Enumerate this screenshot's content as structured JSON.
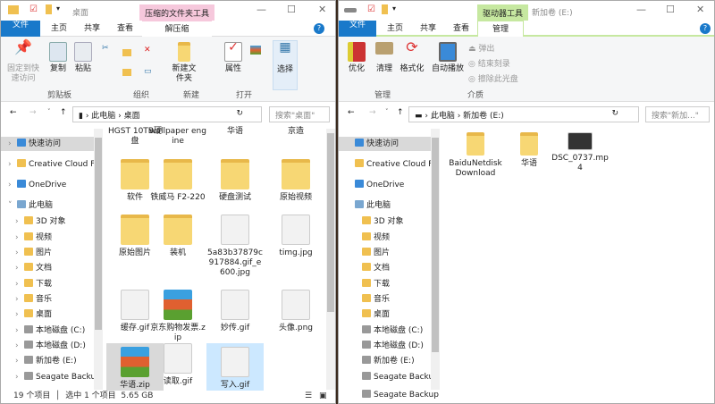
{
  "left": {
    "title": "桌面",
    "context_tab": "压缩的文件夹工具",
    "tabs": [
      "文件",
      "主页",
      "共享",
      "查看",
      "解压缩"
    ],
    "ribbon": {
      "buttons": [
        "固定到快速访问",
        "复制",
        "粘贴",
        "新建文件夹",
        "属性",
        "选择"
      ],
      "groups": [
        "剪贴板",
        "组织",
        "新建",
        "打开"
      ]
    },
    "address": {
      "path": [
        "此电脑",
        "桌面"
      ],
      "search_placeholder": "搜索\"桌面\""
    },
    "nav": [
      "快速访问",
      "Creative Cloud F",
      "OneDrive",
      "此电脑",
      "3D 对象",
      "视频",
      "图片",
      "文档",
      "下载",
      "音乐",
      "桌面",
      "本地磁盘 (C:)",
      "本地磁盘 (D:)",
      "新加卷 (E:)",
      "Seagate Backup"
    ],
    "files": [
      "HGST 10TB硬盘",
      "wallpaper engine",
      "华语",
      "京造",
      "软件",
      "铁威马 F2-220",
      "硬盘测试",
      "原始视频",
      "原始图片",
      "装机",
      "5a83b37879c917884.gif_e600.jpg",
      "timg.jpg",
      "缓存.gif",
      "京东购物发票.zip",
      "妙传.gif",
      "头像.png",
      "华语.zip",
      "读取.gif",
      "写入.gif"
    ],
    "status": {
      "count": "19 个项目",
      "selected": "选中 1 个项目",
      "size": "5.65 GB"
    }
  },
  "right": {
    "title": "新加卷 (E:)",
    "context_tab": "驱动器工具",
    "tabs": [
      "文件",
      "主页",
      "共享",
      "查看",
      "管理"
    ],
    "ribbon": {
      "buttons": [
        "优化",
        "清理",
        "格式化",
        "自动播放"
      ],
      "small": [
        "弹出",
        "结束刻录",
        "擦除此光盘"
      ],
      "groups": [
        "管理",
        "介质"
      ]
    },
    "address": {
      "path": [
        "此电脑",
        "新加卷 (E:)"
      ],
      "search_placeholder": "搜索\"新加...\""
    },
    "nav": [
      "快速访问",
      "Creative Cloud F",
      "OneDrive",
      "此电脑",
      "3D 对象",
      "视频",
      "图片",
      "文档",
      "下载",
      "音乐",
      "桌面",
      "本地磁盘 (C:)",
      "本地磁盘 (D:)",
      "新加卷 (E:)",
      "Seagate Backup",
      "Seagate Backup"
    ],
    "files": [
      "BaiduNetdiskDownload",
      "华语",
      "DSC_0737.mp4"
    ]
  }
}
